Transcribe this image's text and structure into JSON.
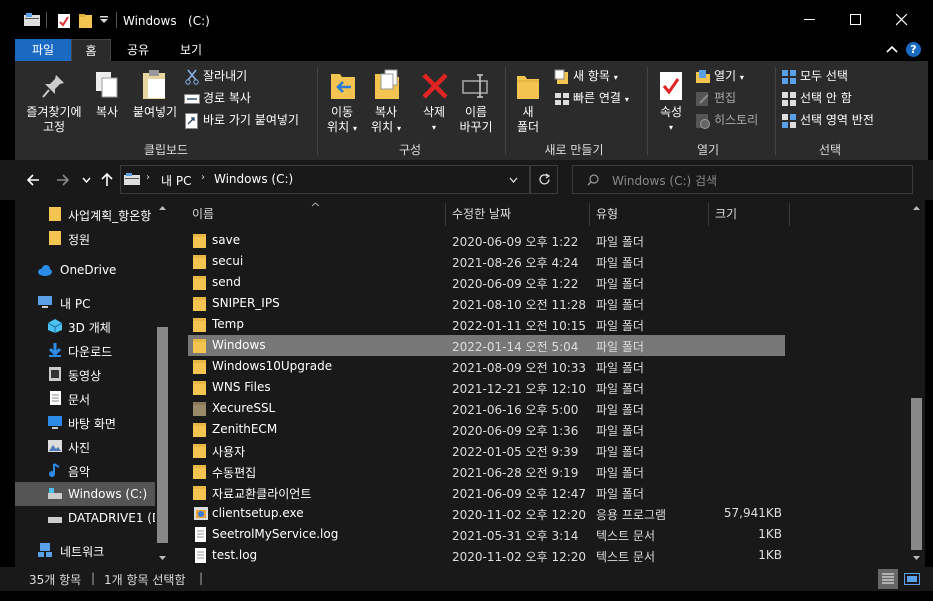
{
  "window": {
    "title": "Windows",
    "title_drive": "(C:)"
  },
  "ribbon_tabs": [
    "파일",
    "홈",
    "공유",
    "보기"
  ],
  "ribbon": {
    "clipboard": {
      "pin_label_1": "즐겨찾기에",
      "pin_label_2": "고정",
      "copy": "복사",
      "paste": "붙여넣기",
      "cut": "잘라내기",
      "copy_path": "경로 복사",
      "paste_shortcut": "바로 가기 붙여넣기",
      "group": "클립보드"
    },
    "organize": {
      "move_1": "이동",
      "move_2": "위치",
      "copy_1": "복사",
      "copy_2": "위치",
      "delete": "삭제",
      "rename_1": "이름",
      "rename_2": "바꾸기",
      "group": "구성"
    },
    "new": {
      "new_folder_1": "새",
      "new_folder_2": "폴더",
      "new_item": "새 항목",
      "easy_access": "빠른 연결",
      "group": "새로 만들기"
    },
    "open": {
      "properties": "속성",
      "open": "열기",
      "edit": "편집",
      "history": "히스토리",
      "group": "열기"
    },
    "select": {
      "select_all": "모두 선택",
      "select_none": "선택 안 함",
      "invert": "선택 영역 반전",
      "group": "선택"
    }
  },
  "address": {
    "crumbs": [
      "내 PC",
      "Windows (C:)"
    ],
    "search_placeholder": "Windows  (C:) 검색"
  },
  "nav": [
    {
      "label": "사업계획_항온항",
      "icon": "folder-icon"
    },
    {
      "label": "정원",
      "icon": "folder-icon"
    },
    {
      "label": "OneDrive",
      "icon": "cloud-icon"
    },
    {
      "label": "내 PC",
      "icon": "pc-icon"
    },
    {
      "label": "3D 개체",
      "icon": "cube-icon"
    },
    {
      "label": "다운로드",
      "icon": "download-icon"
    },
    {
      "label": "동영상",
      "icon": "video-icon"
    },
    {
      "label": "문서",
      "icon": "document-icon"
    },
    {
      "label": "바탕 화면",
      "icon": "desktop-icon"
    },
    {
      "label": "사진",
      "icon": "pictures-icon"
    },
    {
      "label": "음악",
      "icon": "music-icon"
    },
    {
      "label": "Windows  (C:)",
      "icon": "drive-icon"
    },
    {
      "label": "DATADRIVE1 (D",
      "icon": "drive-icon"
    },
    {
      "label": "네트워크",
      "icon": "network-icon"
    }
  ],
  "columns": [
    "이름",
    "수정한 날짜",
    "유형",
    "크기"
  ],
  "files": [
    {
      "name": "save",
      "date": "2020-06-09 오후 1:22",
      "type": "파일 폴더",
      "size": "",
      "kind": "folder"
    },
    {
      "name": "secui",
      "date": "2021-08-26 오후 4:24",
      "type": "파일 폴더",
      "size": "",
      "kind": "folder"
    },
    {
      "name": "send",
      "date": "2020-06-09 오후 1:22",
      "type": "파일 폴더",
      "size": "",
      "kind": "folder"
    },
    {
      "name": "SNIPER_IPS",
      "date": "2021-08-10 오전 11:28",
      "type": "파일 폴더",
      "size": "",
      "kind": "folder"
    },
    {
      "name": "Temp",
      "date": "2022-01-11 오전 10:15",
      "type": "파일 폴더",
      "size": "",
      "kind": "folder"
    },
    {
      "name": "Windows",
      "date": "2022-01-14 오전 5:04",
      "type": "파일 폴더",
      "size": "",
      "kind": "folder",
      "selected": true
    },
    {
      "name": "Windows10Upgrade",
      "date": "2021-08-09 오전 10:33",
      "type": "파일 폴더",
      "size": "",
      "kind": "folder"
    },
    {
      "name": "WNS Files",
      "date": "2021-12-21 오후 12:10",
      "type": "파일 폴더",
      "size": "",
      "kind": "folder"
    },
    {
      "name": "XecureSSL",
      "date": "2021-06-16 오후 5:00",
      "type": "파일 폴더",
      "size": "",
      "kind": "folder-dim"
    },
    {
      "name": "ZenithECM",
      "date": "2020-06-09 오후 1:36",
      "type": "파일 폴더",
      "size": "",
      "kind": "folder"
    },
    {
      "name": "사용자",
      "date": "2022-01-05 오전 9:39",
      "type": "파일 폴더",
      "size": "",
      "kind": "folder"
    },
    {
      "name": "수동편집",
      "date": "2021-06-28 오전 9:19",
      "type": "파일 폴더",
      "size": "",
      "kind": "folder"
    },
    {
      "name": "자료교환클라이언트",
      "date": "2021-06-09 오후 12:47",
      "type": "파일 폴더",
      "size": "",
      "kind": "folder"
    },
    {
      "name": "clientsetup.exe",
      "date": "2020-11-02 오후 12:20",
      "type": "응용 프로그램",
      "size": "57,941KB",
      "kind": "exe"
    },
    {
      "name": "SeetrolMyService.log",
      "date": "2021-05-31 오후 3:14",
      "type": "텍스트 문서",
      "size": "1KB",
      "kind": "text"
    },
    {
      "name": "test.log",
      "date": "2020-11-02 오후 12:20",
      "type": "텍스트 문서",
      "size": "1KB",
      "kind": "text"
    }
  ],
  "status": {
    "count": "35개 항목",
    "selected": "1개 항목 선택함"
  },
  "colors": {
    "file_tab": "#1a6ac2",
    "selection": "#777777",
    "folder": "#f3c44f",
    "help": "#1a6ac2"
  }
}
